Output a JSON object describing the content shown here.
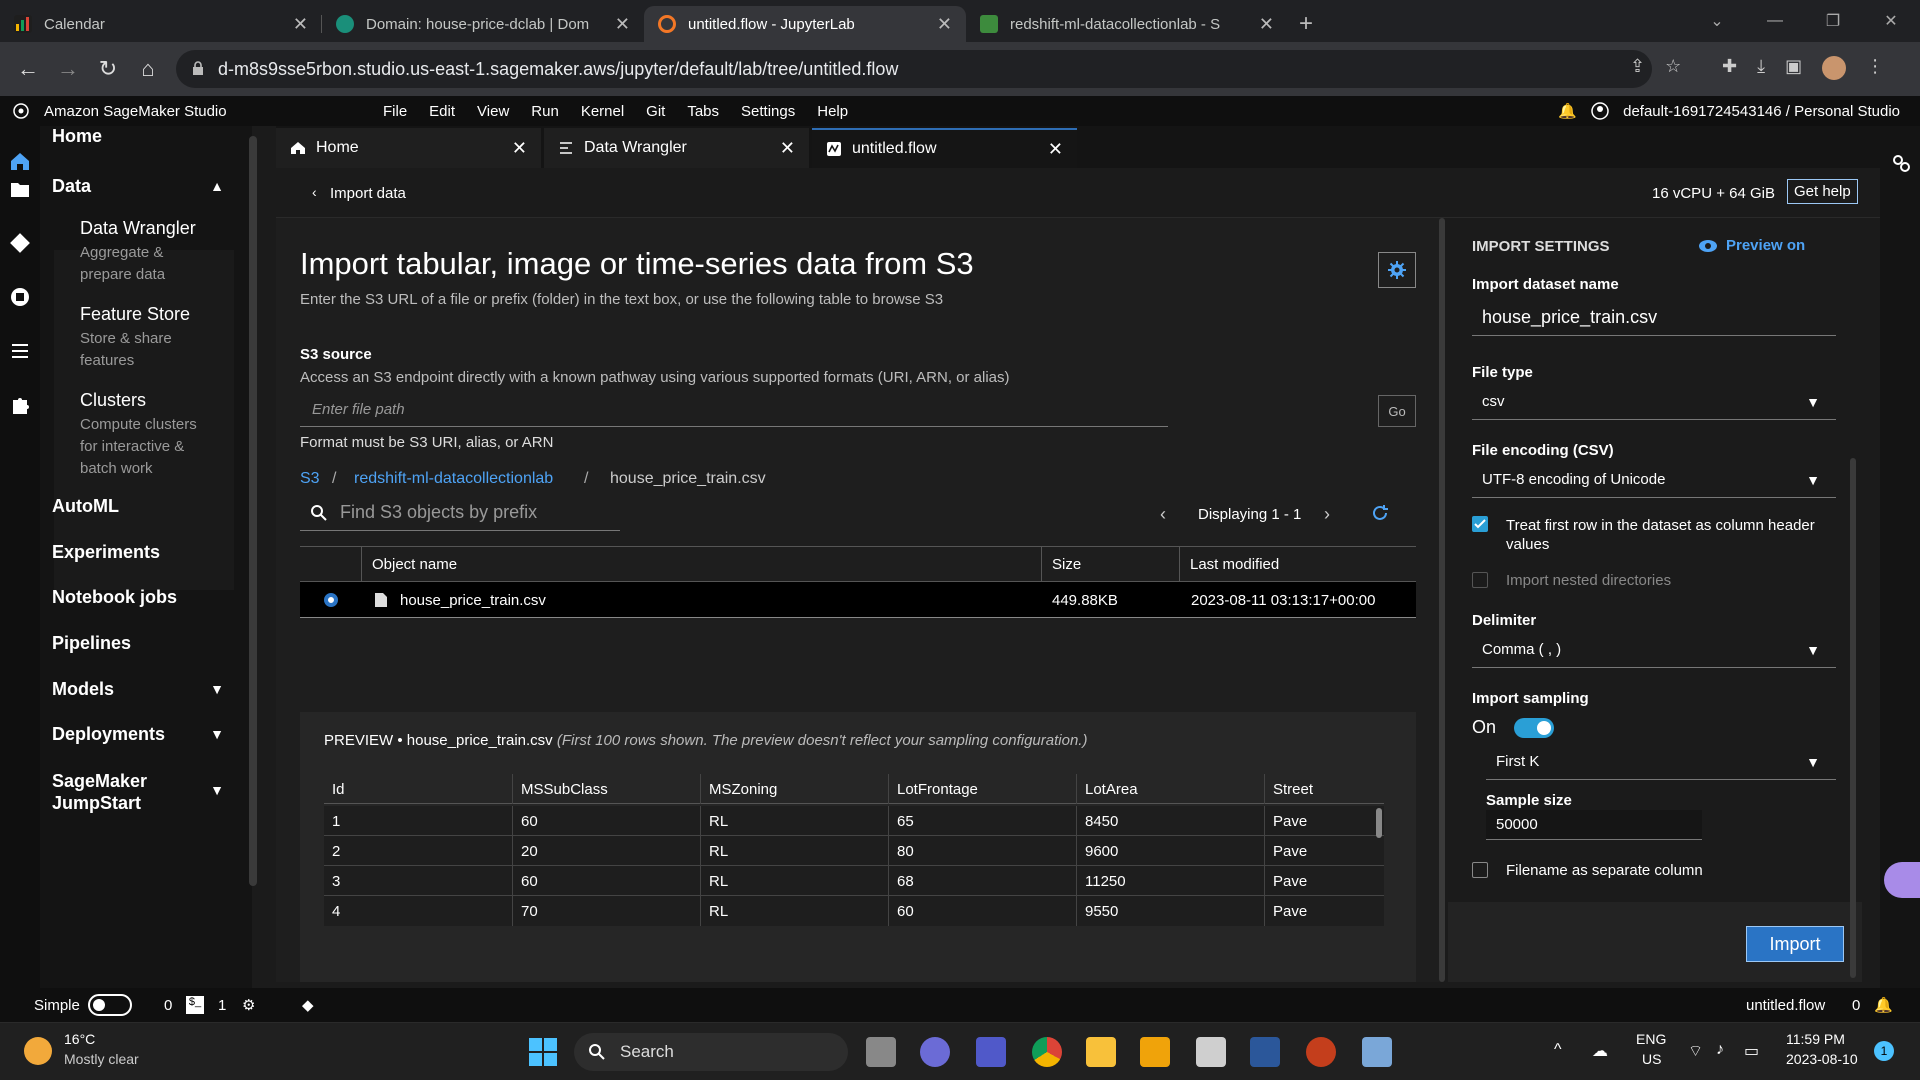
{
  "browser": {
    "tabs": [
      {
        "title": "Calendar"
      },
      {
        "title": "Domain: house-price-dclab | Dom"
      },
      {
        "title": "untitled.flow - JupyterLab"
      },
      {
        "title": "redshift-ml-datacollectionlab - S"
      }
    ],
    "url": "d-m8s9sse5rbon.studio.us-east-1.sagemaker.aws/jupyter/default/lab/tree/untitled.flow"
  },
  "app": {
    "brand": "Amazon SageMaker Studio",
    "menus": [
      "File",
      "Edit",
      "View",
      "Run",
      "Kernel",
      "Git",
      "Tabs",
      "Settings",
      "Help"
    ],
    "user": "default-1691724543146 / Personal Studio"
  },
  "leftnav": {
    "home": "Home",
    "data": "Data",
    "subitems": [
      {
        "title": "Data Wrangler",
        "desc": "Aggregate & prepare data"
      },
      {
        "title": "Feature Store",
        "desc": "Store & share features"
      },
      {
        "title": "Clusters",
        "desc": "Compute clusters for interactive & batch work"
      }
    ],
    "automl": "AutoML",
    "experiments": "Experiments",
    "notebook_jobs": "Notebook jobs",
    "pipelines": "Pipelines",
    "models": "Models",
    "deployments": "Deployments",
    "jumpstart": "SageMaker JumpStart"
  },
  "doctabs": [
    "Home",
    "Data Wrangler",
    "untitled.flow"
  ],
  "topstrip": {
    "back": "Import data",
    "resources": "16 vCPU + 64 GiB",
    "help": "Get help"
  },
  "main": {
    "title": "Import tabular, image or time-series data from S3",
    "subtitle": "Enter the S3 URL of a file or prefix (folder) in the text box, or use the following table to browse S3",
    "s3_source": "S3 source",
    "s3_desc": "Access an S3 endpoint directly with a known pathway using various supported formats (URI, ARN, or alias)",
    "path_placeholder": "Enter file path",
    "go": "Go",
    "format_hint": "Format must be S3 URI, alias, or ARN",
    "breadcrumb": [
      "S3",
      "redshift-ml-datacollectionlab",
      "house_price_train.csv"
    ],
    "search_placeholder": "Find S3 objects by prefix",
    "displaying": "Displaying 1 - 1",
    "table_headers": [
      "Object name",
      "Size",
      "Last modified"
    ],
    "table_row": {
      "name": "house_price_train.csv",
      "size": "449.88KB",
      "modified": "2023-08-11 03:13:17+00:00"
    }
  },
  "preview": {
    "prefix": "PREVIEW • house_price_train.csv",
    "note": "(First 100 rows shown. The preview doesn't reflect your sampling configuration.)",
    "headers": [
      "Id",
      "MSSubClass",
      "MSZoning",
      "LotFrontage",
      "LotArea",
      "Street"
    ],
    "rows": [
      [
        "1",
        "60",
        "RL",
        "65",
        "8450",
        "Pave"
      ],
      [
        "2",
        "20",
        "RL",
        "80",
        "9600",
        "Pave"
      ],
      [
        "3",
        "60",
        "RL",
        "68",
        "11250",
        "Pave"
      ],
      [
        "4",
        "70",
        "RL",
        "60",
        "9550",
        "Pave"
      ]
    ]
  },
  "settings": {
    "heading": "IMPORT SETTINGS",
    "preview_toggle": "Preview on",
    "dataset_label": "Import dataset name",
    "dataset_value": "house_price_train.csv",
    "filetype_label": "File type",
    "filetype_value": "csv",
    "encoding_label": "File encoding (CSV)",
    "encoding_value": "UTF-8 encoding of Unicode",
    "header_row": "Treat first row in the dataset as column header values",
    "nested": "Import nested directories",
    "delimiter_label": "Delimiter",
    "delimiter_value": "Comma ( , )",
    "sampling_label": "Import sampling",
    "sampling_state": "On",
    "sampling_method": "First K",
    "sample_size_label": "Sample size",
    "sample_size_value": "50000",
    "filename_col": "Filename as separate column",
    "import": "Import"
  },
  "status": {
    "mode": "Simple",
    "count_a": "0",
    "count_b": "1",
    "filename": "untitled.flow",
    "notif": "0"
  },
  "taskbar": {
    "temp": "16°C",
    "weather": "Mostly clear",
    "search": "Search",
    "lang": "ENG",
    "region": "US",
    "time": "11:59 PM",
    "date": "2023-08-10",
    "badge": "1"
  }
}
